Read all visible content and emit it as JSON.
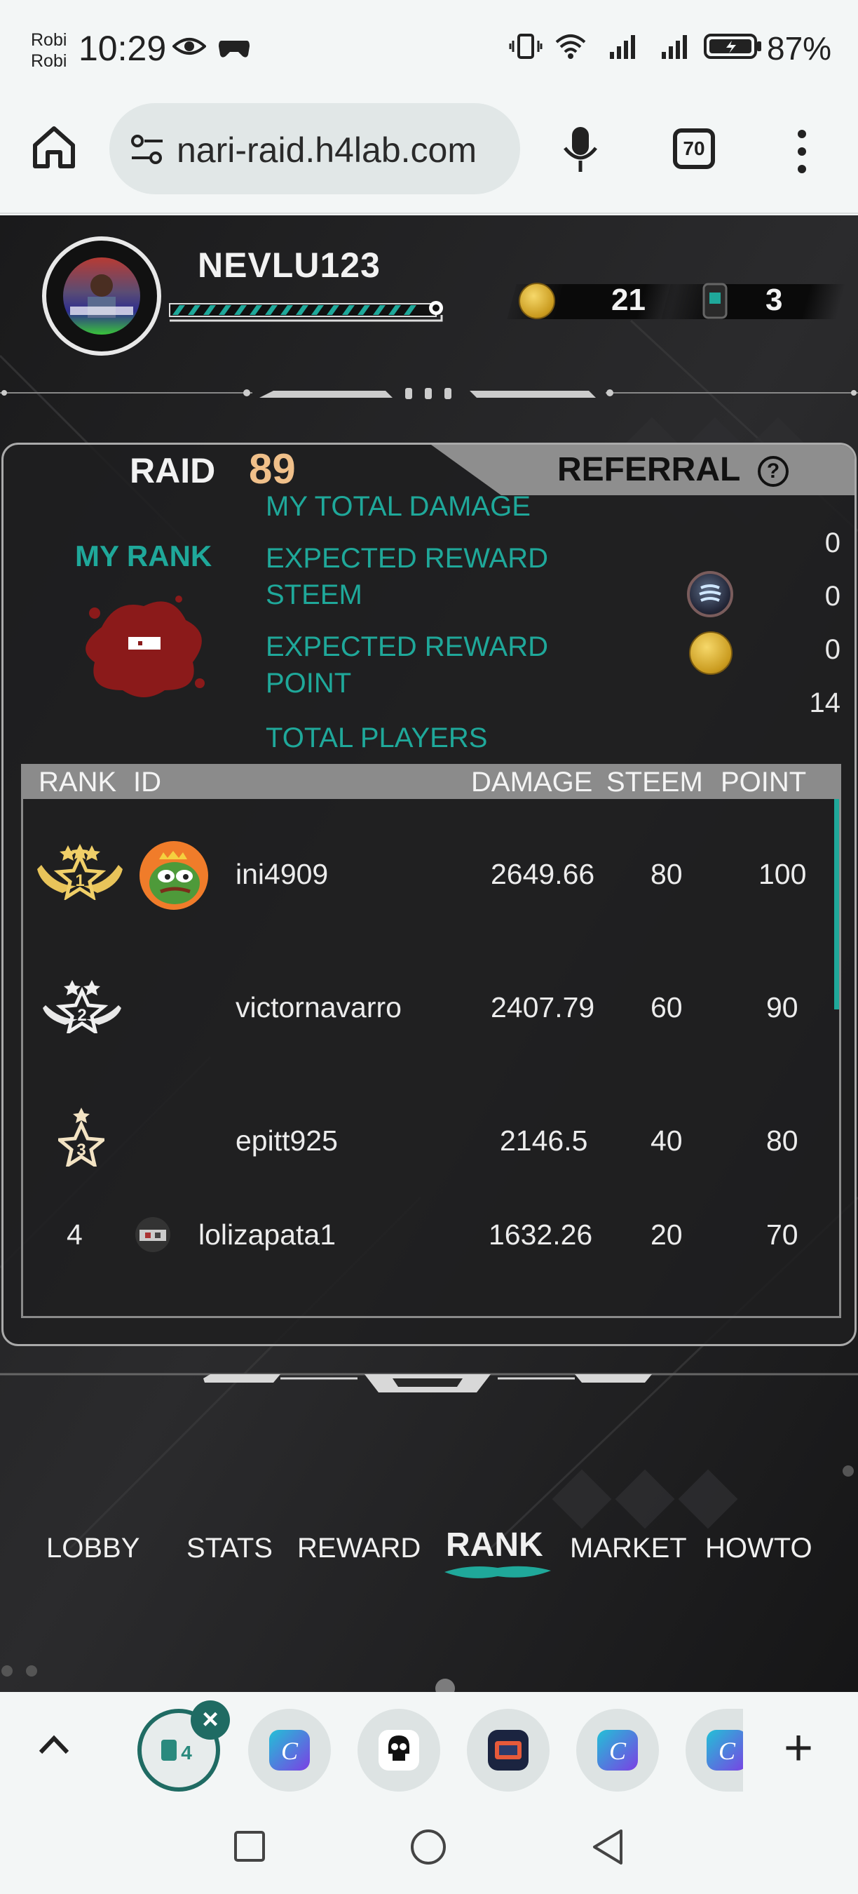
{
  "status_bar": {
    "carrier_1": "Robi",
    "carrier_2": "Robi",
    "time": "10:29",
    "battery": "87%"
  },
  "browser": {
    "url": "nari-raid.h4lab.com",
    "tab_count": "70"
  },
  "player": {
    "name": "NEVLU123",
    "xp_progress": 0.9,
    "coins": "21",
    "tickets": "3"
  },
  "raid_panel": {
    "tab_raid_label": "RAID",
    "raid_number": "89",
    "tab_referral_label": "REFERRAL",
    "help_label": "?",
    "my_rank_label": "MY RANK",
    "stats": [
      {
        "label": "MY TOTAL DAMAGE",
        "value": "0"
      },
      {
        "label": "EXPECTED REWARD STEEM",
        "value": "0"
      },
      {
        "label": "EXPECTED REWARD POINT",
        "value": "0"
      },
      {
        "label": "TOTAL PLAYERS",
        "value": "14"
      }
    ]
  },
  "table": {
    "headers": {
      "rank": "RANK",
      "id": "ID",
      "damage": "DAMAGE",
      "steem": "STEEM",
      "point": "POINT"
    },
    "rows": [
      {
        "rank": "1",
        "id": "ini4909",
        "damage": "2649.66",
        "steem": "80",
        "point": "100"
      },
      {
        "rank": "2",
        "id": "victornavarro",
        "damage": "2407.79",
        "steem": "60",
        "point": "90"
      },
      {
        "rank": "3",
        "id": "epitt925",
        "damage": "2146.5",
        "steem": "40",
        "point": "80"
      },
      {
        "rank": "4",
        "id": "lolizapata1",
        "damage": "1632.26",
        "steem": "20",
        "point": "70"
      }
    ]
  },
  "nav": {
    "items": [
      "LOBBY",
      "STATS",
      "REWARD",
      "RANK",
      "MARKET",
      "HOWTO"
    ],
    "active": "RANK"
  },
  "colors": {
    "accent_teal": "#1fa89a",
    "raid_number": "#f0c08a",
    "blood_red": "#8b1a1a"
  }
}
